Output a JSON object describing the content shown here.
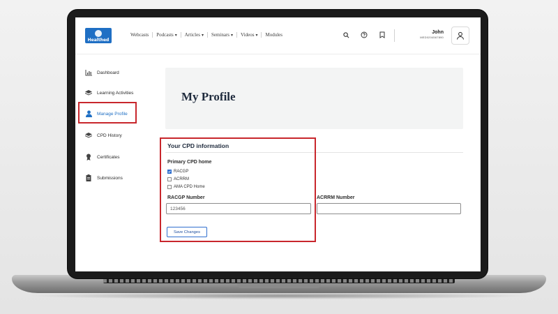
{
  "header": {
    "logo_text": "Healthed",
    "nav": [
      {
        "label": "Webcasts",
        "dropdown": false
      },
      {
        "label": "Podcasts",
        "dropdown": true
      },
      {
        "label": "Articles",
        "dropdown": true
      },
      {
        "label": "Seminars",
        "dropdown": true
      },
      {
        "label": "Videos",
        "dropdown": true
      },
      {
        "label": "Modules",
        "dropdown": false
      }
    ],
    "icons": [
      "search-icon",
      "help-icon",
      "bookmark-icon"
    ],
    "user_name": "John",
    "user_id": "MED0204567890"
  },
  "sidebar": {
    "items": [
      {
        "label": "Dashboard",
        "icon": "chart-icon",
        "active": false
      },
      {
        "label": "Learning Activities",
        "icon": "layers-icon",
        "active": false
      },
      {
        "label": "Manage Profile",
        "icon": "user-icon",
        "active": true
      },
      {
        "label": "CPD History",
        "icon": "layers-icon",
        "active": false
      },
      {
        "label": "Certificates",
        "icon": "award-icon",
        "active": false
      },
      {
        "label": "Submissions",
        "icon": "clipboard-icon",
        "active": false
      }
    ]
  },
  "main": {
    "page_title": "My Profile",
    "section_title": "Your CPD information",
    "primary_cpd_label": "Primary CPD home",
    "options": [
      {
        "label": "RACGP",
        "checked": true
      },
      {
        "label": "ACRRM",
        "checked": false
      },
      {
        "label": "AMA CPD Home",
        "checked": false
      }
    ],
    "racgp_label": "RACGP Number",
    "racgp_value": "123456",
    "acrrm_label": "ACRRM Number",
    "acrrm_value": "",
    "save_label": "Save Changes"
  },
  "colors": {
    "accent": "#1f6fc4",
    "highlight": "#c8262c",
    "title": "#1f2b3d"
  }
}
